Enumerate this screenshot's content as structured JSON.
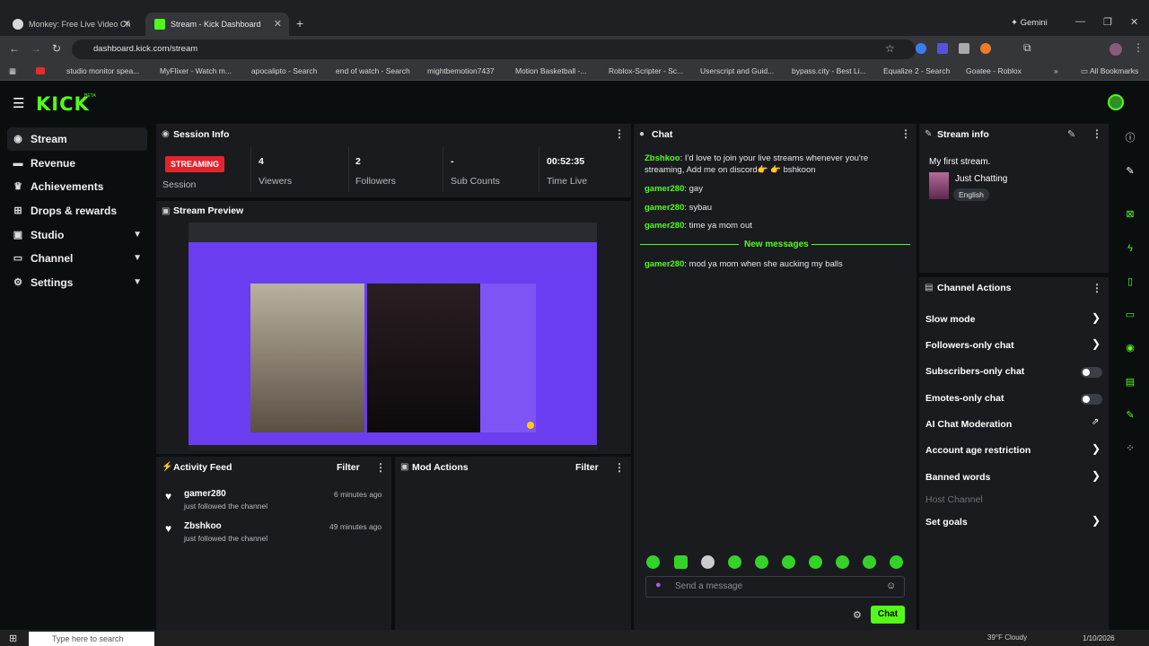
{
  "browser": {
    "tabs": [
      {
        "title": "Monkey: Free Live Video Ch",
        "active": false
      },
      {
        "title": "Stream - Kick Dashboard",
        "active": true
      }
    ],
    "gemini_label": "Gemini",
    "url": "dashboard.kick.com/stream",
    "bookmarks": [
      "studio monitor spea...",
      "MyFlixer - Watch m...",
      "apocalipto - Search",
      "end of watch - Search",
      "mightbemotion7437",
      "Motion Basketball -...",
      "Roblox-Scripter - Sc...",
      "Userscript and Guid...",
      "bypass.city - Best Li...",
      "Equalize 2 - Search",
      "Goatee - Roblox"
    ],
    "all_bookmarks": "All Bookmarks"
  },
  "brand": {
    "logo": "KICK",
    "beta": "BETA",
    "accent": "#53fc18"
  },
  "sidebar": {
    "items": [
      {
        "label": "Stream",
        "icon": "broadcast-icon"
      },
      {
        "label": "Revenue",
        "icon": "wallet-icon"
      },
      {
        "label": "Achievements",
        "icon": "trophy-icon"
      },
      {
        "label": "Drops & rewards",
        "icon": "gift-icon"
      },
      {
        "label": "Studio",
        "icon": "camera-icon"
      },
      {
        "label": "Channel",
        "icon": "monitor-icon"
      },
      {
        "label": "Settings",
        "icon": "gear-icon"
      }
    ]
  },
  "session": {
    "title": "Session Info",
    "status": "STREAMING",
    "status_label": "Session",
    "stats": [
      {
        "value": "4",
        "label": "Viewers"
      },
      {
        "value": "2",
        "label": "Followers"
      },
      {
        "value": "-",
        "label": "Sub Counts"
      },
      {
        "value": "00:52:35",
        "label": "Time Live"
      }
    ]
  },
  "preview": {
    "title": "Stream Preview"
  },
  "activity": {
    "title": "Activity Feed",
    "filter": "Filter",
    "items": [
      {
        "user": "gamer280",
        "action": "just followed the channel",
        "time": "6 minutes ago"
      },
      {
        "user": "Zbshkoo",
        "action": "just followed the channel",
        "time": "49 minutes ago"
      }
    ]
  },
  "mod": {
    "title": "Mod Actions",
    "filter": "Filter"
  },
  "chat": {
    "title": "Chat",
    "messages": [
      {
        "user": "Zbshkoo",
        "text": ": I'd love to join your live streams whenever you're streaming, Add me on discord👉 👉 bshkoon"
      },
      {
        "user": "gamer280",
        "text": ": gay"
      },
      {
        "user": "gamer280",
        "text": ": sybau"
      },
      {
        "user": "gamer280",
        "text": ": time ya mom out"
      }
    ],
    "new_messages": "New messages",
    "new": [
      {
        "user": "gamer280",
        "text": ": mod ya mom when she aucking my balls"
      }
    ],
    "placeholder": "Send a message",
    "send": "Chat"
  },
  "stream_info": {
    "title": "Stream info",
    "stream_title": "My first stream.",
    "category": "Just Chatting",
    "language": "English"
  },
  "channel_actions": {
    "title": "Channel Actions",
    "items": [
      {
        "label": "Slow mode",
        "control": "arrow"
      },
      {
        "label": "Followers-only chat",
        "control": "arrow"
      },
      {
        "label": "Subscribers-only chat",
        "control": "toggle"
      },
      {
        "label": "Emotes-only chat",
        "control": "toggle"
      },
      {
        "label": "AI Chat Moderation",
        "control": "external"
      },
      {
        "label": "Account age restriction",
        "control": "arrow"
      },
      {
        "label": "Banned words",
        "control": "arrow"
      },
      {
        "label": "Host Channel",
        "control": "none"
      },
      {
        "label": "Set goals",
        "control": "arrow"
      }
    ]
  },
  "taskbar": {
    "search": "Type here to search",
    "weather": "39°F Cloudy",
    "date": "1/10/2026"
  }
}
